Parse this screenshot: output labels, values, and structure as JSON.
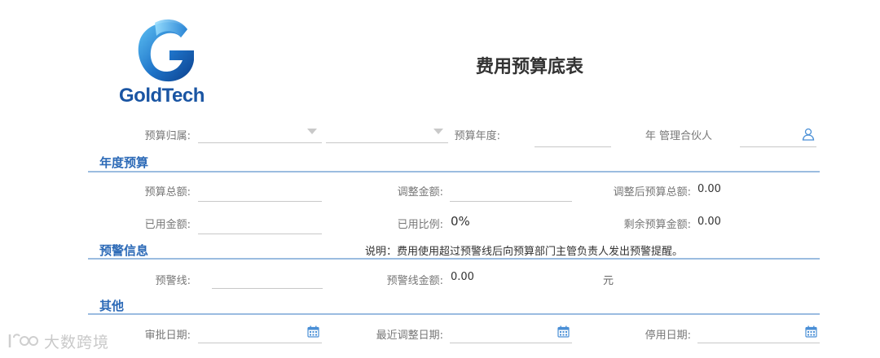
{
  "brand": {
    "logo_text": "GoldTech"
  },
  "page_title": "费用预算底表",
  "header_row": {
    "budget_owner_label": "预算归属:",
    "budget_year_label": "预算年度:",
    "partner_label": "年 管理合伙人"
  },
  "annual_budget": {
    "title": "年度预算",
    "total_label": "预算总额:",
    "adjust_amount_label": "调整金额:",
    "adjusted_total_label": "调整后预算总额:",
    "adjusted_total_value": "0.00",
    "used_amount_label": "已用金额:",
    "used_ratio_label": "已用比例:",
    "used_ratio_value": "0%",
    "remaining_label": "剩余预算金额:",
    "remaining_value": "0.00"
  },
  "warning_info": {
    "title": "预警信息",
    "note": "说明：费用使用超过预警线后向预算部门主管负责人发出预警提醒。",
    "warning_line_label": "预警线:",
    "warning_amount_label": "预警线金额:",
    "warning_amount_value": "0.00",
    "unit": "元"
  },
  "other": {
    "title": "其他",
    "approval_date_label": "审批日期:",
    "recent_adjust_date_label": "最近调整日期:",
    "disable_date_label": "停用日期:"
  },
  "watermark": {
    "text": "大数跨境"
  },
  "colors": {
    "accent": "#2c6ab7",
    "divider": "#9bbce0",
    "brand": "#1a55a3"
  },
  "icons": [
    "user-icon",
    "calendar-icon",
    "dropdown-caret-icon"
  ]
}
